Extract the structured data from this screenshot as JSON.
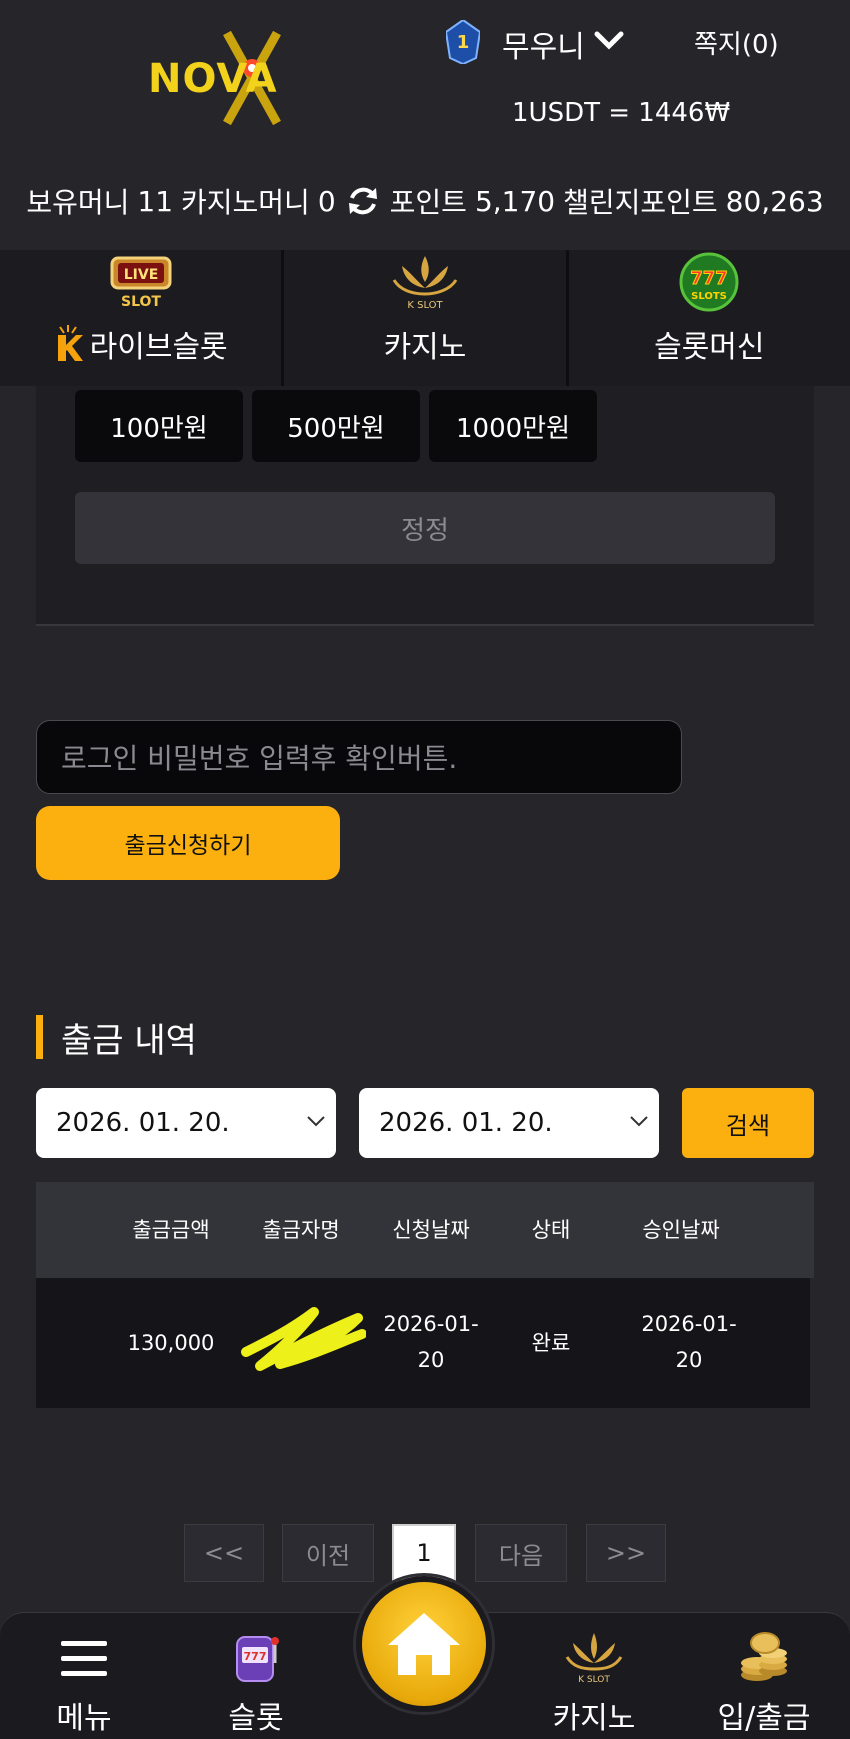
{
  "header": {
    "logo_text": "NOVA",
    "rank_level": "1",
    "username": "무우니",
    "memo_link": "쪽지(0)",
    "exchange_rate": "1USDT = 1446₩"
  },
  "balances": {
    "holding_label": "보유머니",
    "holding_value": "11",
    "casino_label": "카지노머니",
    "casino_value": "0",
    "point_label": "포인트",
    "point_value": "5,170",
    "challenge_label": "챌린지포인트",
    "challenge_value": "80,263"
  },
  "categories": [
    {
      "label": "라이브슬롯",
      "icon": "live-slot-icon"
    },
    {
      "label": "카지노",
      "icon": "k-slot-icon"
    },
    {
      "label": "슬롯머신",
      "icon": "777-slots-icon"
    }
  ],
  "amount_buttons": [
    "100만원",
    "500만원",
    "1000만원"
  ],
  "reset_label": "정정",
  "password_placeholder": "로그인 비밀번호 입력후 확인버튼.",
  "withdraw_button": "출금신청하기",
  "history": {
    "title": "출금 내역",
    "date_from": "2026. 01. 20.",
    "date_to": "2026. 01. 20.",
    "search_button": "검색",
    "columns": [
      "출금금액",
      "출금자명",
      "신청날짜",
      "상태",
      "승인날짜"
    ],
    "rows": [
      {
        "amount": "130,000",
        "name": "",
        "request_date_1": "2026-01-",
        "request_date_2": "20",
        "status": "완료",
        "approve_date_1": "2026-01-",
        "approve_date_2": "20"
      }
    ]
  },
  "pagination": {
    "first": "<<",
    "prev": "이전",
    "current": "1",
    "next": "다음",
    "last": ">>"
  },
  "bottom_nav": {
    "menu": "메뉴",
    "slot": "슬롯",
    "casino": "카지노",
    "deposit": "입/출금"
  },
  "colors": {
    "accent": "#fbb00f",
    "background": "#26252a"
  }
}
